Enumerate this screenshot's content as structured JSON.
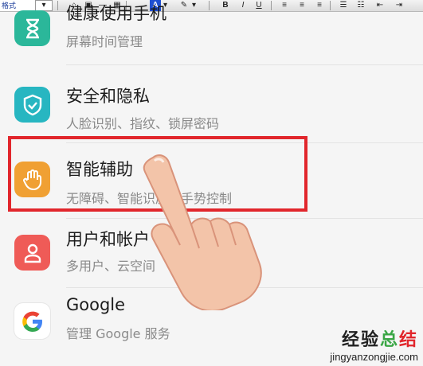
{
  "toolbar": {
    "style_label": "格式",
    "bold": "B",
    "italic": "I",
    "underline": "U",
    "font_color": "A"
  },
  "settings": {
    "items": [
      {
        "title": "健康使用手机",
        "subtitle": "屏幕时间管理",
        "icon": "hourglass-icon",
        "color": "#2bb79a"
      },
      {
        "title": "安全和隐私",
        "subtitle": "人脸识别、指纹、锁屏密码",
        "icon": "shield-icon",
        "color": "#27b6c1"
      },
      {
        "title": "智能辅助",
        "subtitle": "无障碍、智能识屏、手势控制",
        "icon": "hand-icon",
        "color": "#f0a033"
      },
      {
        "title": "用户和帐户",
        "subtitle": "多用户、云空间",
        "icon": "user-icon",
        "color": "#ef5b57"
      },
      {
        "title": "Google",
        "subtitle": "管理 Google 服务",
        "icon": "google-icon",
        "color": "#ffffff"
      }
    ]
  },
  "highlight_color": "#e1262c",
  "watermark": {
    "name": "经验总结",
    "url": "jingyanzongjie.com"
  }
}
